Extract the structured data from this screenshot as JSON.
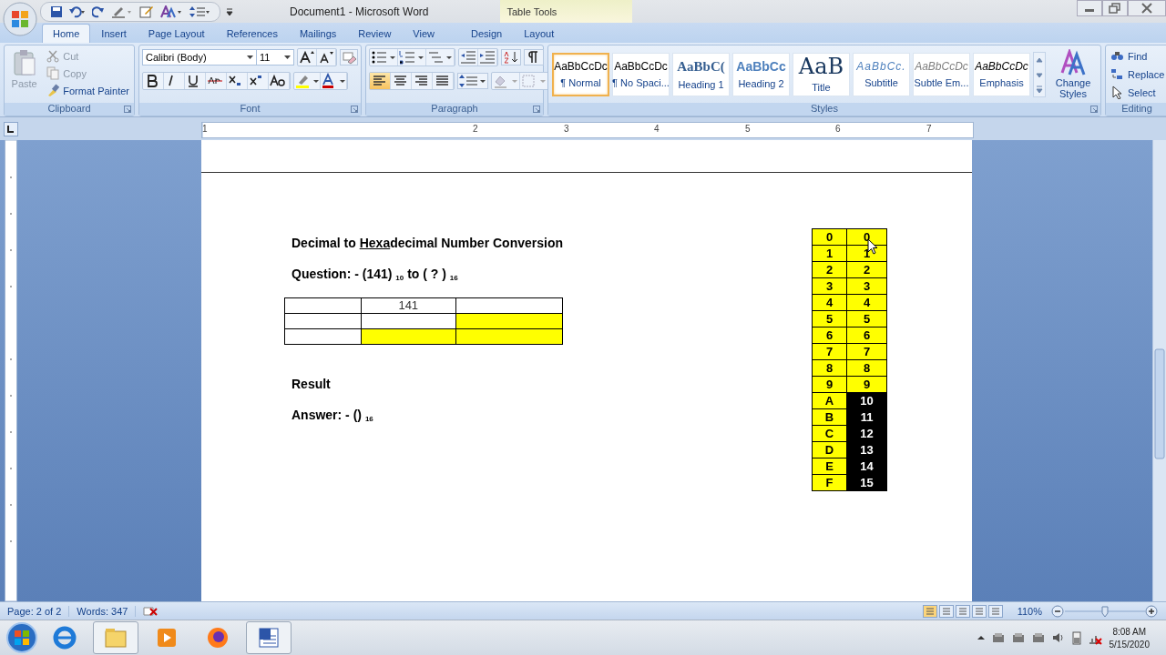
{
  "window": {
    "title": "Document1 - Microsoft Word",
    "context_group": "Table Tools"
  },
  "tabs": [
    {
      "label": "Home",
      "selected": true
    },
    {
      "label": "Insert",
      "selected": false
    },
    {
      "label": "Page Layout",
      "selected": false
    },
    {
      "label": "References",
      "selected": false
    },
    {
      "label": "Mailings",
      "selected": false
    },
    {
      "label": "Review",
      "selected": false
    },
    {
      "label": "View",
      "selected": false
    },
    {
      "label": "Design",
      "selected": false
    },
    {
      "label": "Layout",
      "selected": false
    }
  ],
  "clipboard": {
    "group": "Clipboard",
    "paste": "Paste",
    "items": [
      {
        "kind": "cut",
        "label": "Cut",
        "disabled": true
      },
      {
        "kind": "copy",
        "label": "Copy",
        "disabled": true
      },
      {
        "kind": "painter",
        "label": "Format Painter",
        "disabled": false
      }
    ]
  },
  "font": {
    "group": "Font",
    "name": "Calibri (Body)",
    "size": "11"
  },
  "paragraph": {
    "group": "Paragraph",
    "alignment": [
      {
        "kind": "left",
        "selected": true
      },
      {
        "kind": "center",
        "selected": false
      },
      {
        "kind": "right",
        "selected": false
      },
      {
        "kind": "justify",
        "selected": false
      }
    ]
  },
  "styles": {
    "group": "Styles",
    "change": "Change Styles",
    "items": [
      {
        "kind": "normal",
        "preview": "AaBbCcDc",
        "label": "¶ Normal",
        "selected": true
      },
      {
        "kind": "normal",
        "preview": "AaBbCcDc",
        "label": "¶ No Spaci...",
        "selected": false
      },
      {
        "kind": "heading1",
        "preview": "AaBbC(",
        "label": "Heading 1",
        "selected": false
      },
      {
        "kind": "heading2",
        "preview": "AaBbCc",
        "label": "Heading 2",
        "selected": false
      },
      {
        "kind": "title",
        "preview": "AaB",
        "label": "Title",
        "selected": false
      },
      {
        "kind": "subtitle",
        "preview": "AaBbCc.",
        "label": "Subtitle",
        "selected": false
      },
      {
        "kind": "subtle",
        "preview": "AaBbCcDc",
        "label": "Subtle Em...",
        "selected": false
      },
      {
        "kind": "emphasis",
        "preview": "AaBbCcDc",
        "label": "Emphasis",
        "selected": false
      }
    ]
  },
  "editing": {
    "group": "Editing",
    "items": [
      {
        "kind": "find",
        "label": "Find"
      },
      {
        "kind": "replace",
        "label": "Replace"
      },
      {
        "kind": "select",
        "label": "Select"
      }
    ]
  },
  "ruler": {
    "numbers": [
      "1",
      "2",
      "3",
      "4",
      "5",
      "6",
      "7"
    ]
  },
  "document": {
    "heading": [
      {
        "text": "Decimal to ",
        "underline": false
      },
      {
        "text": "Hexa",
        "underline": true
      },
      {
        "text": "decimal Number Conversion",
        "underline": false
      }
    ],
    "question": "Question: - (141) $_{10}$ to (   ?   ) $_{16}$",
    "work_table": [
      [
        {
          "highlight": false
        },
        {
          "text": "141",
          "highlight": false
        },
        {
          "highlight": false
        }
      ],
      [
        {
          "highlight": false
        },
        {
          "highlight": false
        },
        {
          "highlight": true
        }
      ],
      [
        {
          "highlight": false
        },
        {
          "highlight": true
        },
        {
          "highlight": true
        }
      ]
    ],
    "result": "Result",
    "answer": "Answer: - () $_{16}$",
    "hex_table": [
      {
        "hex": "0",
        "dec": "0",
        "dark": false
      },
      {
        "hex": "1",
        "dec": "1",
        "dark": false
      },
      {
        "hex": "2",
        "dec": "2",
        "dark": false
      },
      {
        "hex": "3",
        "dec": "3",
        "dark": false
      },
      {
        "hex": "4",
        "dec": "4",
        "dark": false
      },
      {
        "hex": "5",
        "dec": "5",
        "dark": false
      },
      {
        "hex": "6",
        "dec": "6",
        "dark": false
      },
      {
        "hex": "7",
        "dec": "7",
        "dark": false
      },
      {
        "hex": "8",
        "dec": "8",
        "dark": false
      },
      {
        "hex": "9",
        "dec": "9",
        "dark": false
      },
      {
        "hex": "A",
        "dec": "10",
        "dark": true
      },
      {
        "hex": "B",
        "dec": "11",
        "dark": true
      },
      {
        "hex": "C",
        "dec": "12",
        "dark": true
      },
      {
        "hex": "D",
        "dec": "13",
        "dark": true
      },
      {
        "hex": "E",
        "dec": "14",
        "dark": true
      },
      {
        "hex": "F",
        "dec": "15",
        "dark": true
      }
    ]
  },
  "status_bar": {
    "page": "Page: 2 of 2",
    "words": "Words: 347",
    "zoom": "110%",
    "zoom_slider": {
      "level": 0.5
    }
  },
  "taskbar": {
    "time": "8:08 AM",
    "date": "5/15/2020"
  }
}
